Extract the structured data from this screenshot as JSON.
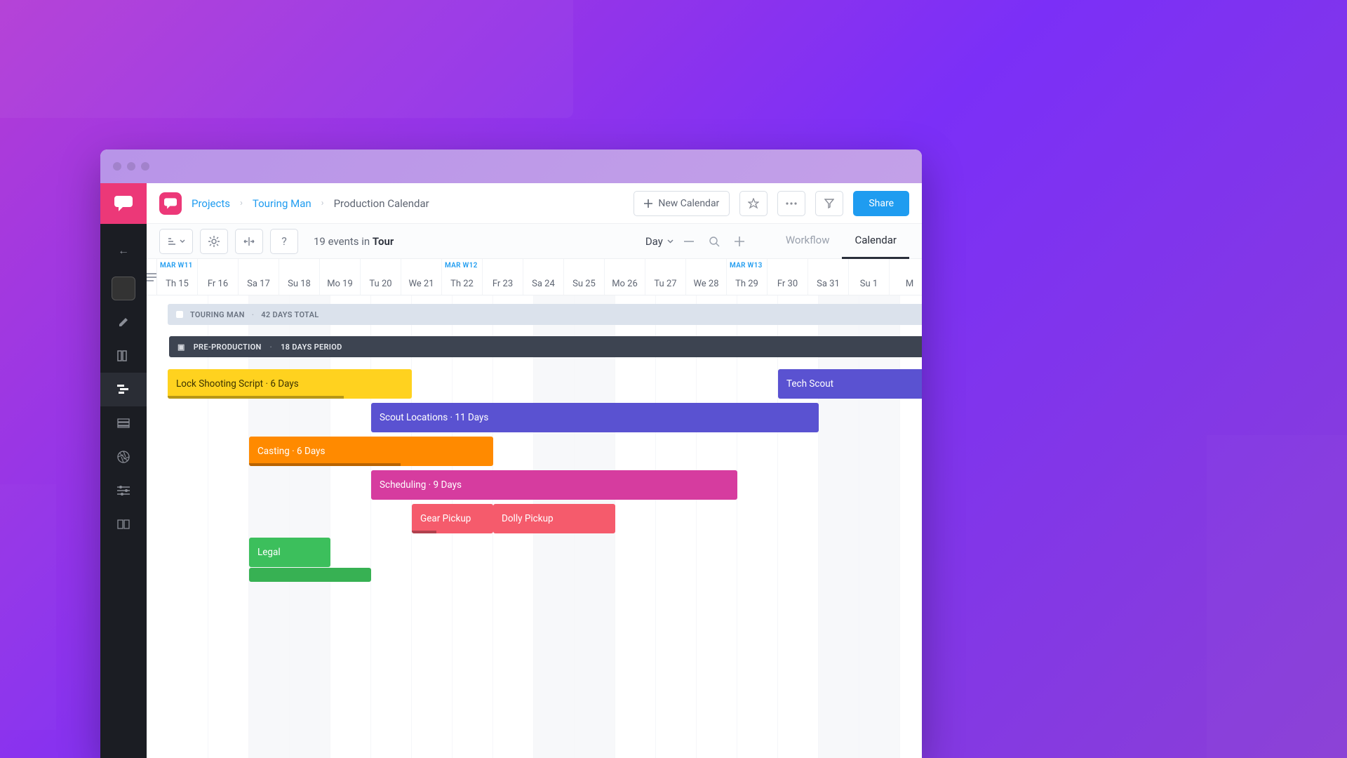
{
  "breadcrumb": {
    "root": "Projects",
    "project": "Touring Man",
    "page": "Production Calendar"
  },
  "header": {
    "new_calendar": "New Calendar",
    "share": "Share"
  },
  "toolbar": {
    "event_count": "19",
    "event_word": "events in",
    "event_scope": "Tour",
    "scale_label": "Day",
    "view_workflow": "Workflow",
    "view_calendar": "Calendar"
  },
  "weeks": [
    {
      "label": "MAR  W11",
      "col": 0
    },
    {
      "label": "MAR  W12",
      "col": 7
    },
    {
      "label": "MAR  W13",
      "col": 14
    }
  ],
  "dates": [
    "Th 15",
    "Fr 16",
    "Sa 17",
    "Su 18",
    "Mo 19",
    "Tu 20",
    "We 21",
    "Th 22",
    "Fr 23",
    "Sa 24",
    "Su 25",
    "Mo 26",
    "Tu 27",
    "We 28",
    "Th 29",
    "Fr 30",
    "Sa 31",
    "Su 1",
    "M"
  ],
  "weekends": [
    2,
    3,
    9,
    10,
    16,
    17
  ],
  "summary": {
    "title": "TOURING MAN",
    "meta": "42 DAYS TOTAL"
  },
  "phase": {
    "title": "PRE-PRODUCTION",
    "meta": "18 DAYS PERIOD"
  },
  "tasks": [
    {
      "lane": 0,
      "start": 0,
      "span": 6,
      "color": "yellow",
      "label": "Lock Shooting Script · 6 Days",
      "progress": 0.72
    },
    {
      "lane": 0,
      "start": 15,
      "span": 6,
      "color": "indigo",
      "label": "Tech Scout"
    },
    {
      "lane": 1,
      "start": 5,
      "span": 11,
      "color": "indigo",
      "label": "Scout Locations · 11 Days"
    },
    {
      "lane": 2,
      "start": 2,
      "span": 6,
      "color": "orange",
      "label": "Casting · 6 Days",
      "progress": 0.62
    },
    {
      "lane": 3,
      "start": 5,
      "span": 9,
      "color": "magenta",
      "label": "Scheduling · 9 Days"
    },
    {
      "lane": 4,
      "start": 6,
      "span": 2,
      "color": "coral",
      "label": "Gear Pickup",
      "progress": 0.3
    },
    {
      "lane": 4,
      "start": 8,
      "span": 3,
      "color": "coral",
      "label": "Dolly Pickup"
    },
    {
      "lane": 5,
      "start": 2,
      "span": 2,
      "color": "green",
      "label": "Legal"
    },
    {
      "lane": 5,
      "start": 2,
      "span": 3,
      "color": "green2",
      "label": ""
    }
  ],
  "icons": {
    "back": "←"
  }
}
